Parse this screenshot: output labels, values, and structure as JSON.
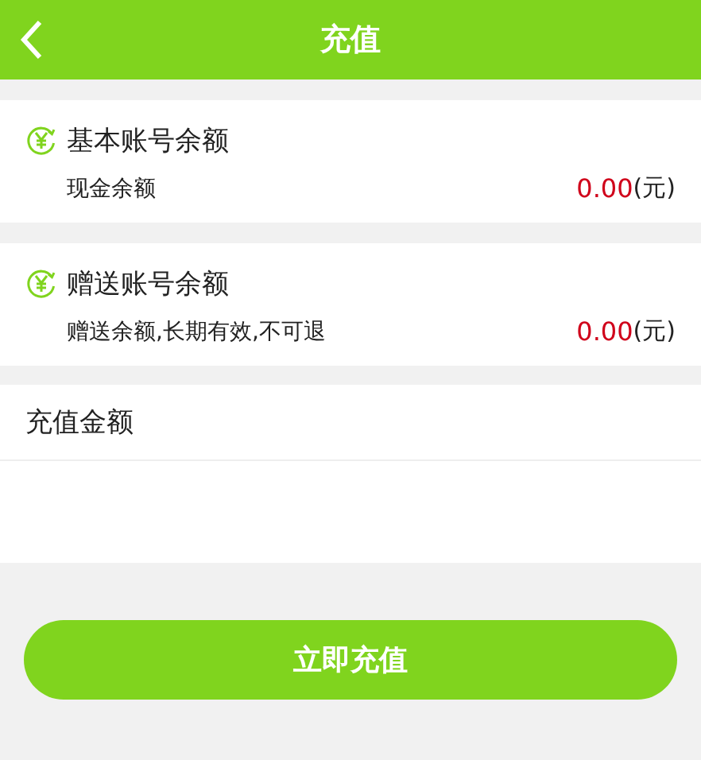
{
  "header": {
    "title": "充值"
  },
  "accounts": [
    {
      "title": "基本账号余额",
      "label": "现金余额",
      "amount": "0.00",
      "unit": "(元)"
    },
    {
      "title": "赠送账号余额",
      "label": "赠送余额,长期有效,不可退",
      "amount": "0.00",
      "unit": "(元)"
    }
  ],
  "recharge": {
    "label": "充值金额"
  },
  "submit": {
    "label": "立即充值"
  }
}
